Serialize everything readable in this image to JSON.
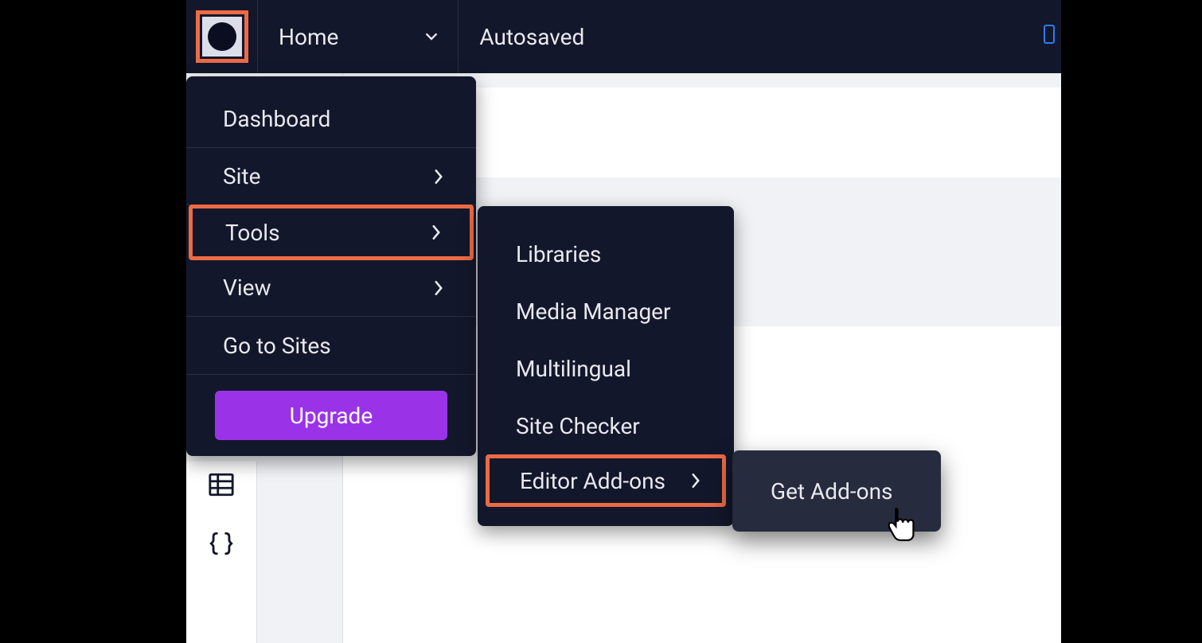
{
  "header": {
    "page_label": "Home",
    "status": "Autosaved"
  },
  "main_menu": {
    "items": [
      {
        "label": "Dashboard",
        "has_submenu": false
      },
      {
        "label": "Site",
        "has_submenu": true
      },
      {
        "label": "Tools",
        "has_submenu": true,
        "highlighted": true
      },
      {
        "label": "View",
        "has_submenu": true
      },
      {
        "label": "Go to Sites",
        "has_submenu": false
      }
    ],
    "upgrade_label": "Upgrade"
  },
  "tools_submenu": {
    "items": [
      {
        "label": "Libraries"
      },
      {
        "label": "Media Manager"
      },
      {
        "label": "Multilingual"
      },
      {
        "label": "Site Checker"
      },
      {
        "label": "Editor Add-ons",
        "has_submenu": true,
        "highlighted": true
      }
    ]
  },
  "addons_submenu": {
    "items": [
      {
        "label": "Get Add-ons"
      }
    ]
  },
  "colors": {
    "highlight": "#ec6b45",
    "upgrade": "#9a33e8",
    "menu_bg": "#13172b"
  }
}
